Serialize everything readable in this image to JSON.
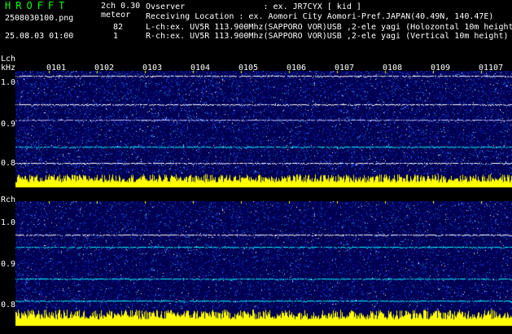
{
  "header": {
    "app_title": "HROFFT",
    "version": "2ch 0.30",
    "mode": "meteor",
    "file_name": "2508030100.png",
    "date_time": "25.08.03 01:00",
    "count_lch": "82",
    "count_rch": "1",
    "observer": "Ovserver                : ex. JR7CYX [ kid ]",
    "location": "Receiving Location : ex. Aomori City Aomori-Pref.JAPAN(40.49N, 140.47E)",
    "lch_info": "L-ch:ex. UV5R 113.900Mhz(SAPPORO VOR)USB ,2-ele yagi (Holozontal 10m height)",
    "rch_info": "R-ch:ex. UV5R 113.900Mhz(SAPPORO VOR)USB ,2-ele yagi (Vertical 10m height)"
  },
  "time_ticks": [
    "0101",
    "0102",
    "0103",
    "0104",
    "0105",
    "0106",
    "0107",
    "0108",
    "0109",
    "01107"
  ],
  "lch": {
    "label": "Lch",
    "unit": "kHz",
    "y_ticks": [
      "1.0",
      "0.9",
      "0.8"
    ]
  },
  "rch": {
    "label": "Rch",
    "y_ticks": [
      "1.0",
      "0.9",
      "0.8"
    ]
  },
  "colors": {
    "background": "#000000",
    "grid": "#ffff00",
    "noise_low": "#000066",
    "noise_high": "#3050ff",
    "signal": "#ffff00",
    "cyan": "#00ffff"
  }
}
